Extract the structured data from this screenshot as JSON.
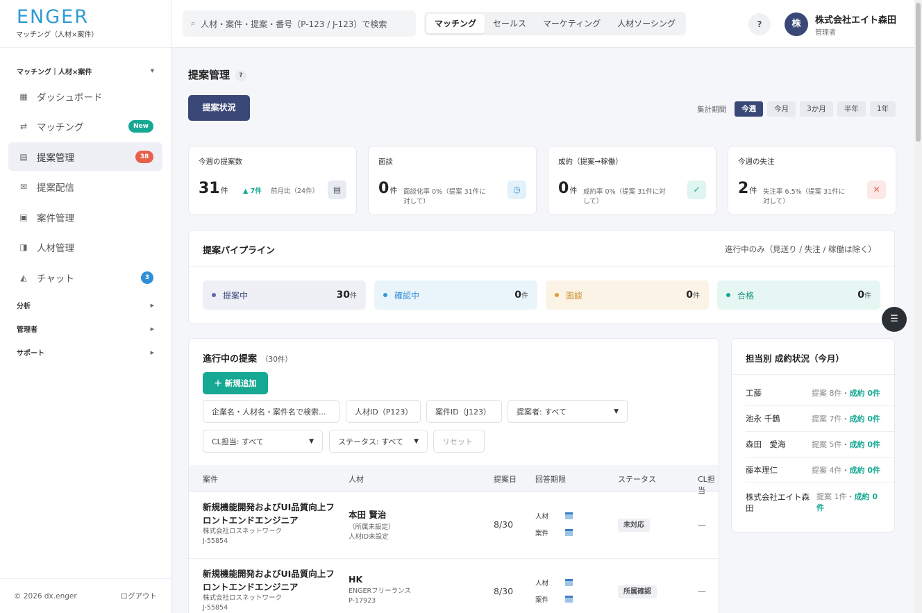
{
  "app": {
    "logo": "ENGER",
    "logo_sub": "マッチング（人材×案件）"
  },
  "sidebar": {
    "section_main": "マッチング｜人材×案件",
    "items": [
      {
        "label": "ダッシュボード",
        "icon": "grid-icon"
      },
      {
        "label": "マッチング",
        "icon": "swap-icon",
        "badge": "New"
      },
      {
        "label": "提案管理",
        "icon": "list-icon",
        "badge": "38"
      },
      {
        "label": "提案配信",
        "icon": "mail-icon"
      },
      {
        "label": "案件管理",
        "icon": "square-icon"
      },
      {
        "label": "人材管理",
        "icon": "person-card-icon"
      },
      {
        "label": "チャット",
        "icon": "chat-icon",
        "badge": "3"
      }
    ],
    "sections": [
      "分析",
      "管理者",
      "サポート"
    ],
    "copyright": "© 2026 dx.enger",
    "logout": "ログアウト"
  },
  "topbar": {
    "search_placeholder": "人材・案件・提案・番号（P-123 / J-123）で検索",
    "tabs": [
      "マッチング",
      "セールス",
      "マーケティング",
      "人材ソーシング"
    ],
    "help": "?",
    "avatar": "株",
    "user_name": "株式会社エイト森田",
    "user_role": "管理者"
  },
  "page": {
    "title": "提案管理",
    "help": "?",
    "status_button": "提案状況",
    "period_label": "集計期間",
    "periods": [
      "今週",
      "今月",
      "3か月",
      "半年",
      "1年"
    ]
  },
  "kpis": [
    {
      "title": "今週の提案数",
      "value": "31",
      "unit": "件",
      "delta": "▲ 7件",
      "note": "前月比（24件）",
      "icon": "list-icon"
    },
    {
      "title": "面談",
      "value": "0",
      "unit": "件",
      "note": "面談化率 0%（提案 31件に対して）",
      "icon": "clock-icon"
    },
    {
      "title": "成約（提案→稼働）",
      "value": "0",
      "unit": "件",
      "note": "成約率 0%（提案 31件に対して）",
      "icon": "check-icon"
    },
    {
      "title": "今週の失注",
      "value": "2",
      "unit": "件",
      "note": "失注率 6.5%（提案 31件に対して）",
      "icon": "x-icon"
    }
  ],
  "pipeline": {
    "title": "提案パイプライン",
    "note": "進行中のみ（見送り / 失注 / 稼働は除く）",
    "unit": "件",
    "stages": [
      {
        "label": "提案中",
        "count": "30",
        "color": "#5b6aa8"
      },
      {
        "label": "確認中",
        "count": "0",
        "color": "#2e9bd6"
      },
      {
        "label": "面談",
        "count": "0",
        "color": "#e0a030"
      },
      {
        "label": "合格",
        "count": "0",
        "color": "#16a892"
      }
    ]
  },
  "proposals": {
    "title": "進行中の提案",
    "count": "（30件）",
    "add_button": "＋ 新規追加",
    "filters": {
      "keyword_placeholder": "企業名・人材名・案件名で検索...",
      "talent_id_placeholder": "人材ID（P123）",
      "job_id_placeholder": "案件ID（J123）",
      "proposer": "提案者: すべて",
      "cl_owner": "CL担当: すべて",
      "status": "ステータス: すべて",
      "reset": "リセット"
    },
    "columns": [
      "案件",
      "人材",
      "提案日",
      "回答期限",
      "ステータス",
      "CL担当"
    ],
    "rows": [
      {
        "job_title": "新規機能開発およびUI品質向上フロントエンドエンジニア",
        "company": "株式会社ロスネットワーク",
        "job_id": "J-55854",
        "talent": "本田 賢治",
        "talent_sub1": "（所属未設定）",
        "talent_sub2": "人材ID未設定",
        "date": "8/30",
        "deadline_talent": "人材",
        "deadline_job": "案件",
        "status": "未対応",
        "cl": "—"
      },
      {
        "job_title": "新規機能開発およびUI品質向上フロントエンドエンジニア",
        "company": "株式会社ロスネットワーク",
        "job_id": "J-55854",
        "talent": "HK",
        "talent_sub1": "ENGERフリーランス",
        "talent_sub2": "P-17923",
        "date": "8/30",
        "deadline_talent": "人材",
        "deadline_job": "案件",
        "status": "所属確認",
        "cl": "—"
      }
    ]
  },
  "reps": {
    "title": "担当別 成約状況（今月）",
    "list": [
      {
        "name": "工藤",
        "proposals": "提案 8件",
        "sep": "・",
        "wins": "成約 0件"
      },
      {
        "name": "池永 千鶴",
        "proposals": "提案 7件",
        "sep": "・",
        "wins": "成約 0件"
      },
      {
        "name": "森田　愛海",
        "proposals": "提案 5件",
        "sep": "・",
        "wins": "成約 0件"
      },
      {
        "name": "藤本理仁",
        "proposals": "提案 4件",
        "sep": "・",
        "wins": "成約 0件"
      },
      {
        "name": "株式会社エイト森田",
        "proposals": "提案 1件",
        "sep": "・",
        "wins": "成約 0件"
      }
    ]
  },
  "colors": {
    "primary": "#3a4878",
    "accent": "#16a892",
    "brand": "#2e9bd6",
    "danger": "#e8604c"
  }
}
